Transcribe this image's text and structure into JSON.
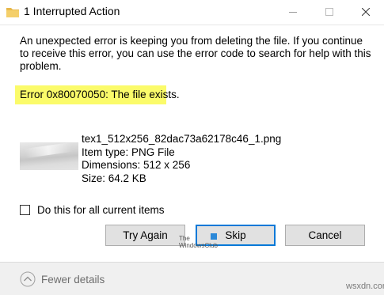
{
  "window": {
    "title": "1 Interrupted Action",
    "icon": "folder-icon"
  },
  "message": "An unexpected error is keeping you from deleting the file. If you continue to receive this error, you can use the error code to search for help with this problem.",
  "error": {
    "text": "Error 0x80070050: The file exists.",
    "highlight_color": "#fbfb6a"
  },
  "file": {
    "name": "tex1_512x256_82dac73a62178c46_1.png",
    "type": "Item type: PNG File",
    "dimensions": "Dimensions: 512 x 256",
    "size": "Size: 64.2 KB"
  },
  "checkbox": {
    "label": "Do this for all current items",
    "checked": false
  },
  "buttons": {
    "try_again": "Try Again",
    "skip": "Skip",
    "cancel": "Cancel"
  },
  "watermark": {
    "line1": "The",
    "line2": "WindowsClub"
  },
  "footer": {
    "fewer_details": "Fewer details",
    "site": "wsxdn.com"
  },
  "colors": {
    "focus_border": "#0078d7",
    "button_bg": "#e1e1e1",
    "footer_bg": "#f0f0f0"
  }
}
